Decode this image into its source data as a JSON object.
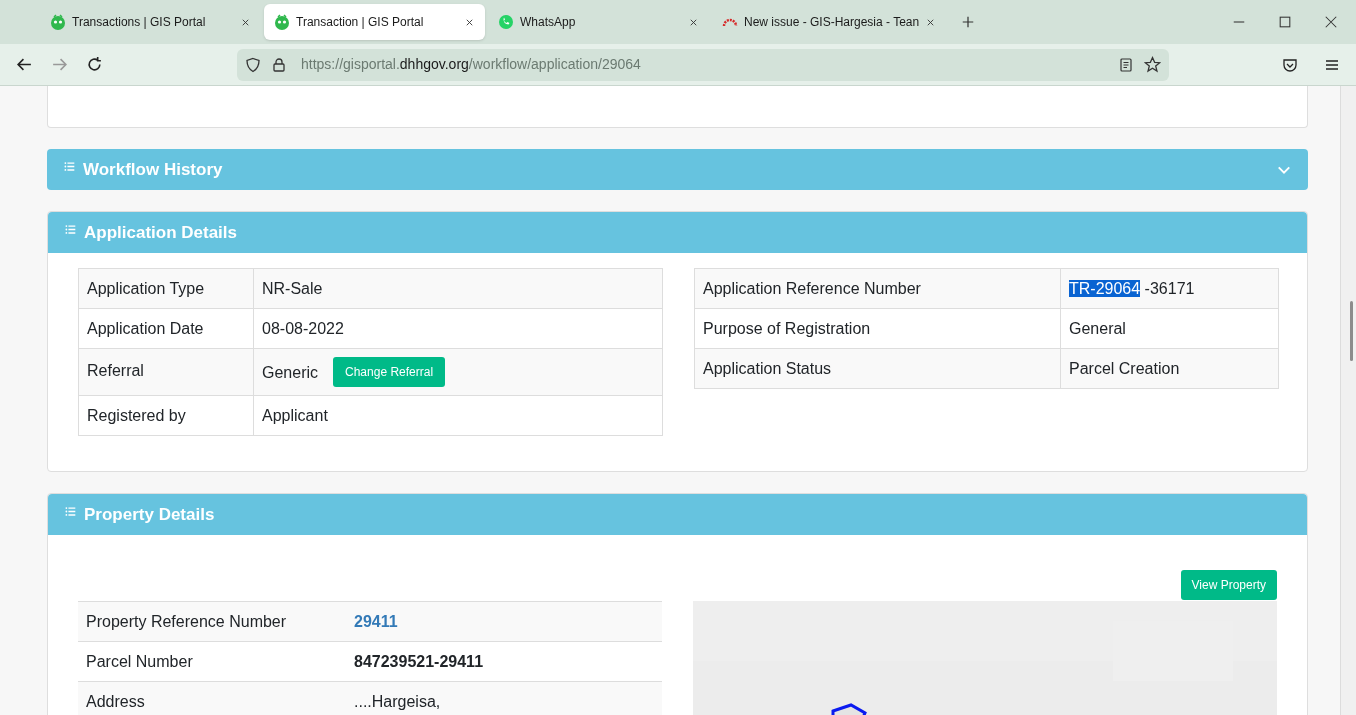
{
  "browser": {
    "tabs": [
      {
        "title": "Transactions | GIS Portal",
        "kind": "portal",
        "selected": false
      },
      {
        "title": "Transaction | GIS Portal",
        "kind": "portal",
        "selected": true
      },
      {
        "title": "WhatsApp",
        "kind": "whatsapp",
        "selected": false
      },
      {
        "title": "New issue - GIS-Hargesia - Tean",
        "kind": "gauge",
        "selected": false
      }
    ],
    "url": {
      "scheme_host": "https://gisportal.",
      "domain": "dhhgov.org",
      "path": "/workflow/application/29064"
    }
  },
  "workflow_history": {
    "title": "Workflow History",
    "expanded": false
  },
  "application_details": {
    "title": "Application Details",
    "left_rows": [
      {
        "label": "Application Type",
        "value": "NR-Sale"
      },
      {
        "label": "Application Date",
        "value": "08-08-2022"
      },
      {
        "label": "Referral",
        "value": "Generic",
        "button": "Change Referral"
      },
      {
        "label": "Registered by",
        "value": "Applicant"
      }
    ],
    "right_rows": [
      {
        "label": "Application Reference Number",
        "value_parts": [
          {
            "text": "TR-29064",
            "highlighted": true
          },
          {
            "text": " -36171",
            "highlighted": false
          }
        ]
      },
      {
        "label": "Purpose of Registration",
        "value_parts": [
          {
            "text": "General",
            "highlighted": false
          }
        ]
      },
      {
        "label": "Application Status",
        "value_parts": [
          {
            "text": "Parcel Creation",
            "highlighted": false
          }
        ]
      }
    ]
  },
  "property_details": {
    "title": "Property Details",
    "view_button": "View Property",
    "rows": [
      {
        "label": "Property Reference Number",
        "value": "29411",
        "kind": "link"
      },
      {
        "label": "Parcel Number",
        "value": "847239521-29411",
        "kind": "bold"
      },
      {
        "label": "Address",
        "value": "....Hargeisa,",
        "kind": "plain"
      }
    ]
  }
}
